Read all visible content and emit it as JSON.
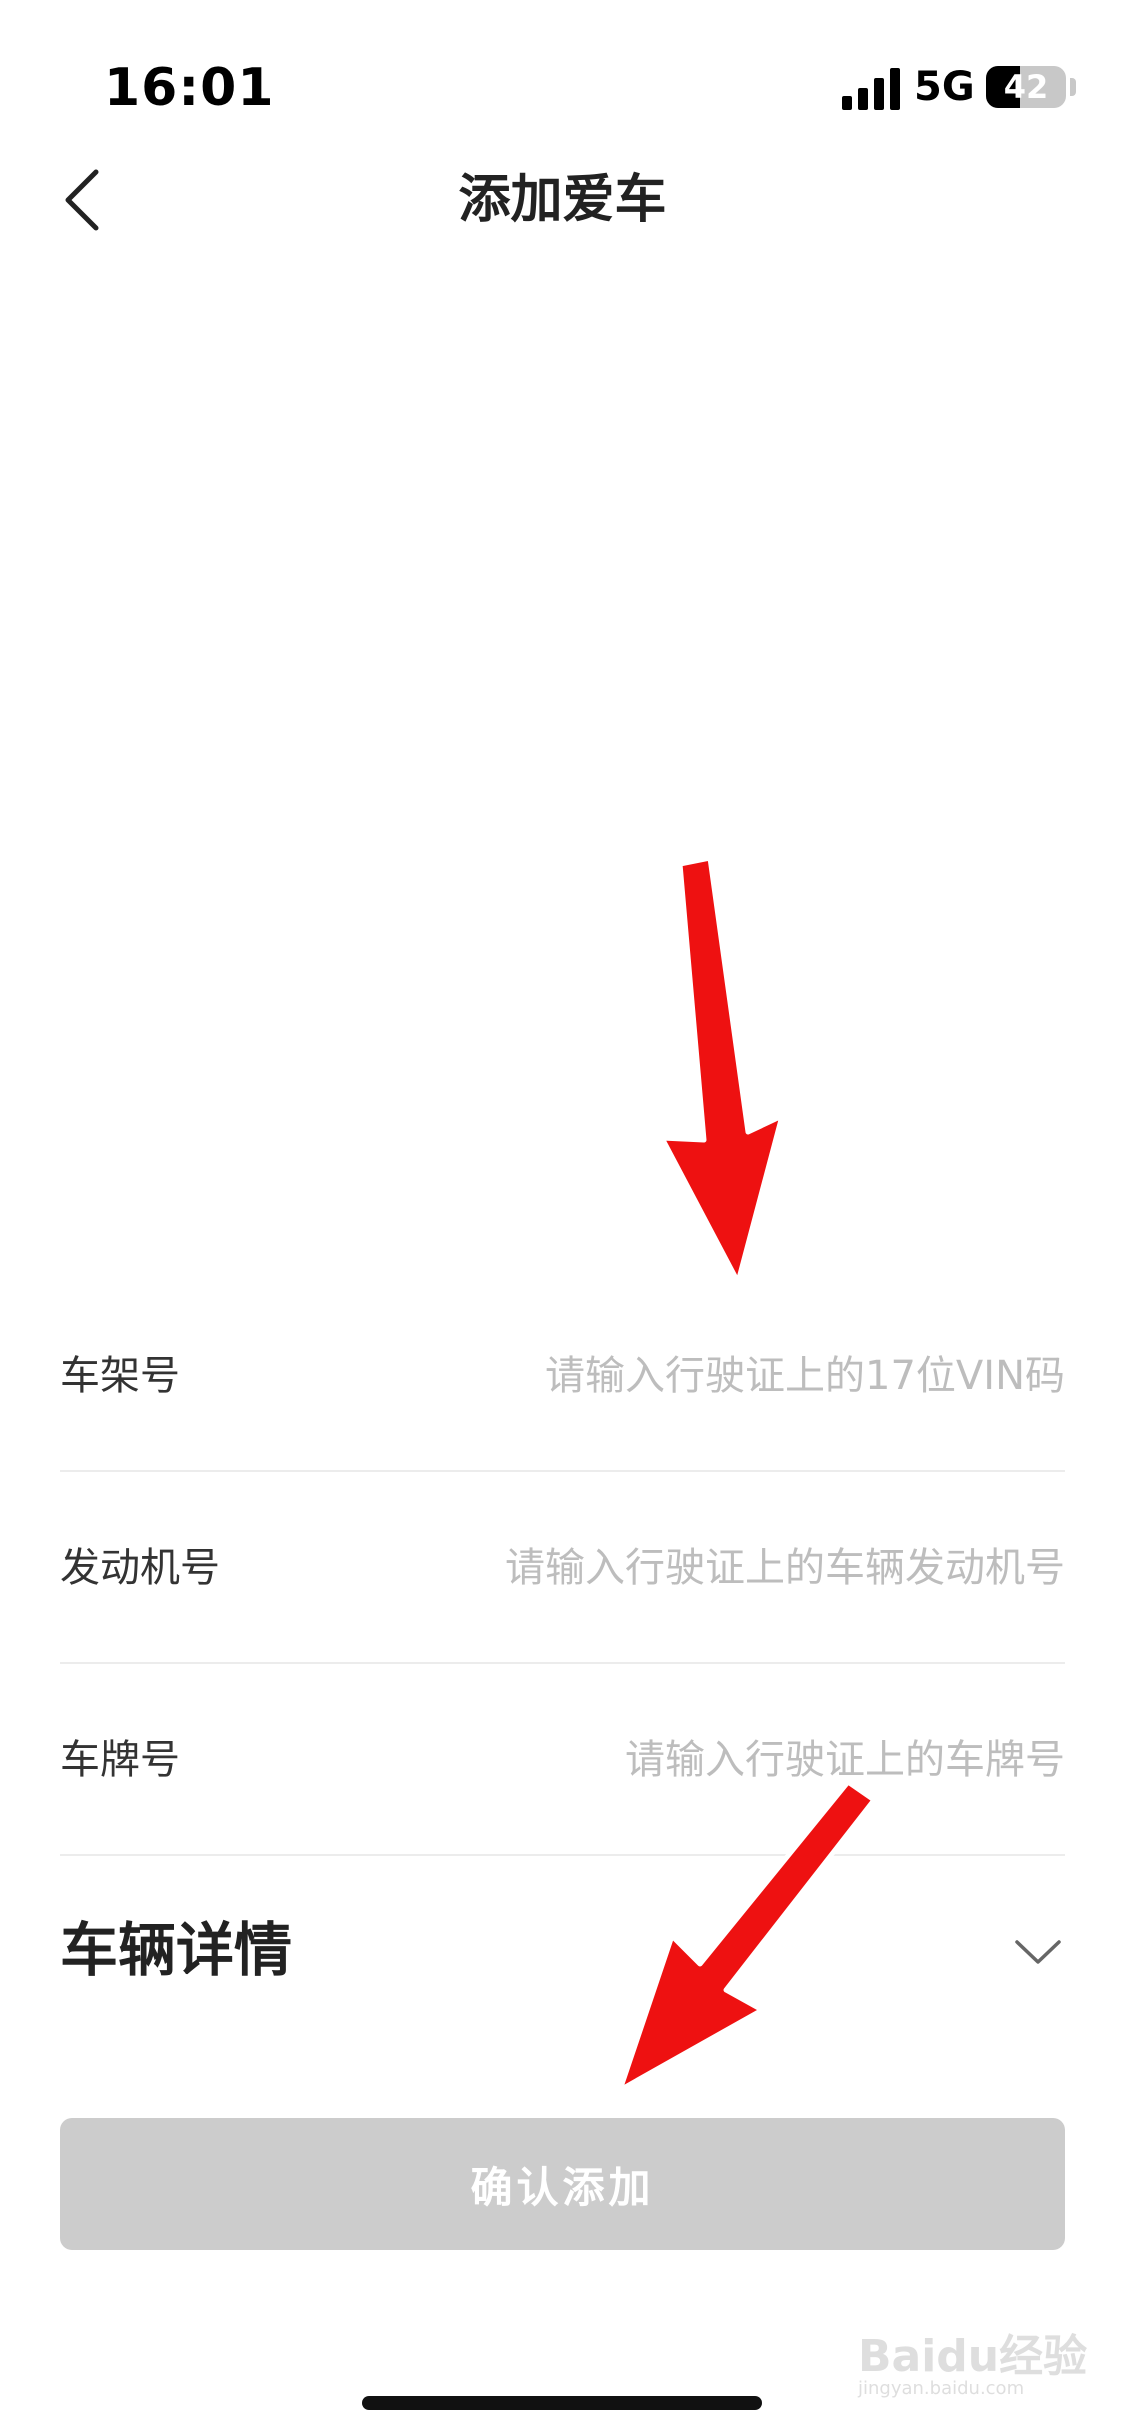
{
  "status_bar": {
    "time": "16:01",
    "network": "5G",
    "battery": {
      "text": "42",
      "level": 0.42
    }
  },
  "nav": {
    "title": "添加爱车",
    "back_icon": "chevron-left-icon"
  },
  "form": {
    "rows": [
      {
        "label": "车架号",
        "placeholder": "请输入行驶证上的17位VIN码",
        "value": ""
      },
      {
        "label": "发动机号",
        "placeholder": "请输入行驶证上的车辆发动机号",
        "value": ""
      },
      {
        "label": "车牌号",
        "placeholder": "请输入行驶证上的车牌号",
        "value": ""
      }
    ]
  },
  "details": {
    "label": "车辆详情",
    "icon": "chevron-down-icon"
  },
  "confirm": {
    "label": "确认添加",
    "color": "#cccccc"
  },
  "annotations": {
    "arrow_color": "#ee1111"
  },
  "watermark": {
    "brand": "Baidu经验",
    "url": "jingyan.baidu.com"
  }
}
